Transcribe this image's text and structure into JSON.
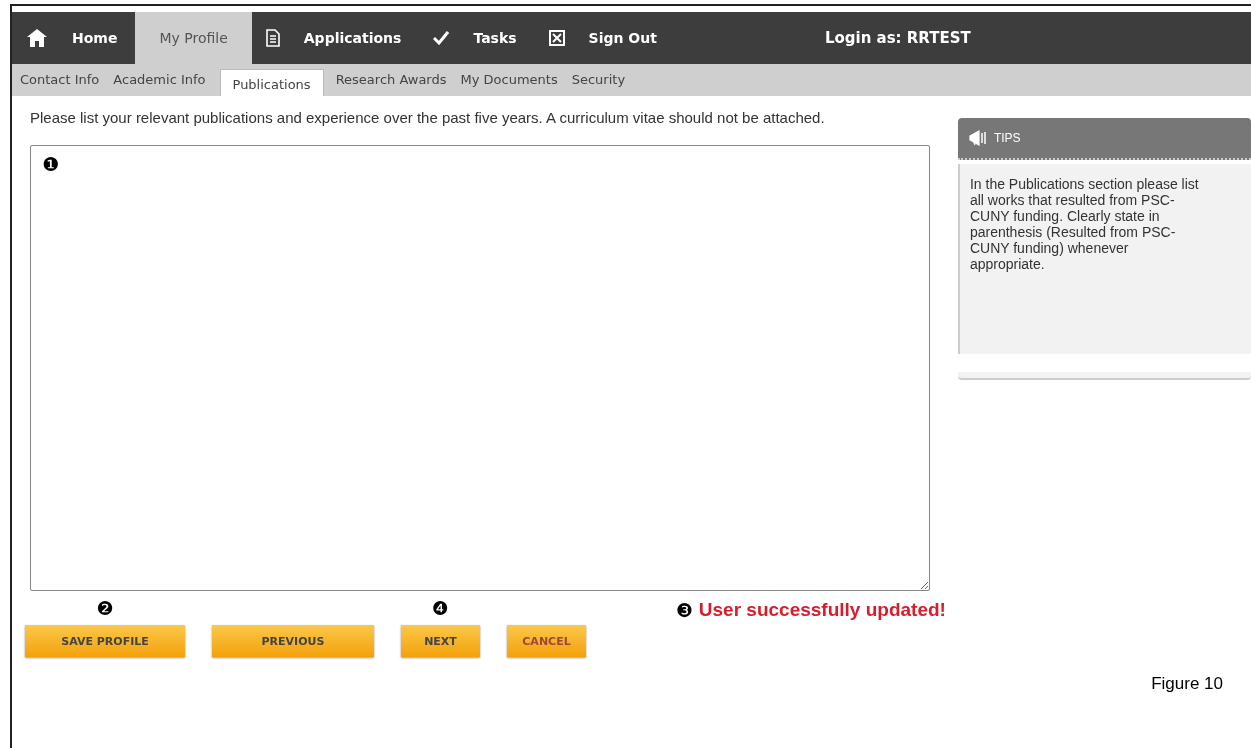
{
  "nav": {
    "items": [
      {
        "label": "Home",
        "selected": false
      },
      {
        "label": "My Profile",
        "selected": true
      },
      {
        "label": "Applications",
        "selected": false
      },
      {
        "label": "Tasks",
        "selected": false
      },
      {
        "label": "Sign Out",
        "selected": false
      }
    ],
    "login": "Login as: RRTEST"
  },
  "subnav": [
    {
      "label": "Contact Info",
      "selected": false
    },
    {
      "label": "Academic Info",
      "selected": false
    },
    {
      "label": "Publications",
      "selected": true
    },
    {
      "label": "Research Awards",
      "selected": false
    },
    {
      "label": "My Documents",
      "selected": false
    },
    {
      "label": "Security",
      "selected": false
    }
  ],
  "instructions": "Please list your relevant publications and experience over the past five years.  A curriculum vitae should not be attached.",
  "textarea_callout": "❶",
  "tips": {
    "title": "TIPS",
    "text": "In the Publications section please list all works that resulted from PSC-CUNY funding. Clearly state in parenthesis (Resulted from PSC-CUNY funding) whenever appropriate."
  },
  "status": {
    "callout": "❸",
    "message": "User successfully updated!"
  },
  "buttons": [
    {
      "label": "SAVE PROFILE",
      "kind": "normal",
      "callout": "❷"
    },
    {
      "label": "PREVIOUS",
      "kind": "normal"
    },
    {
      "label": "NEXT",
      "kind": "normal",
      "callout": "❹"
    },
    {
      "label": "CANCEL",
      "kind": "cancel"
    }
  ],
  "caption": "Figure 10"
}
